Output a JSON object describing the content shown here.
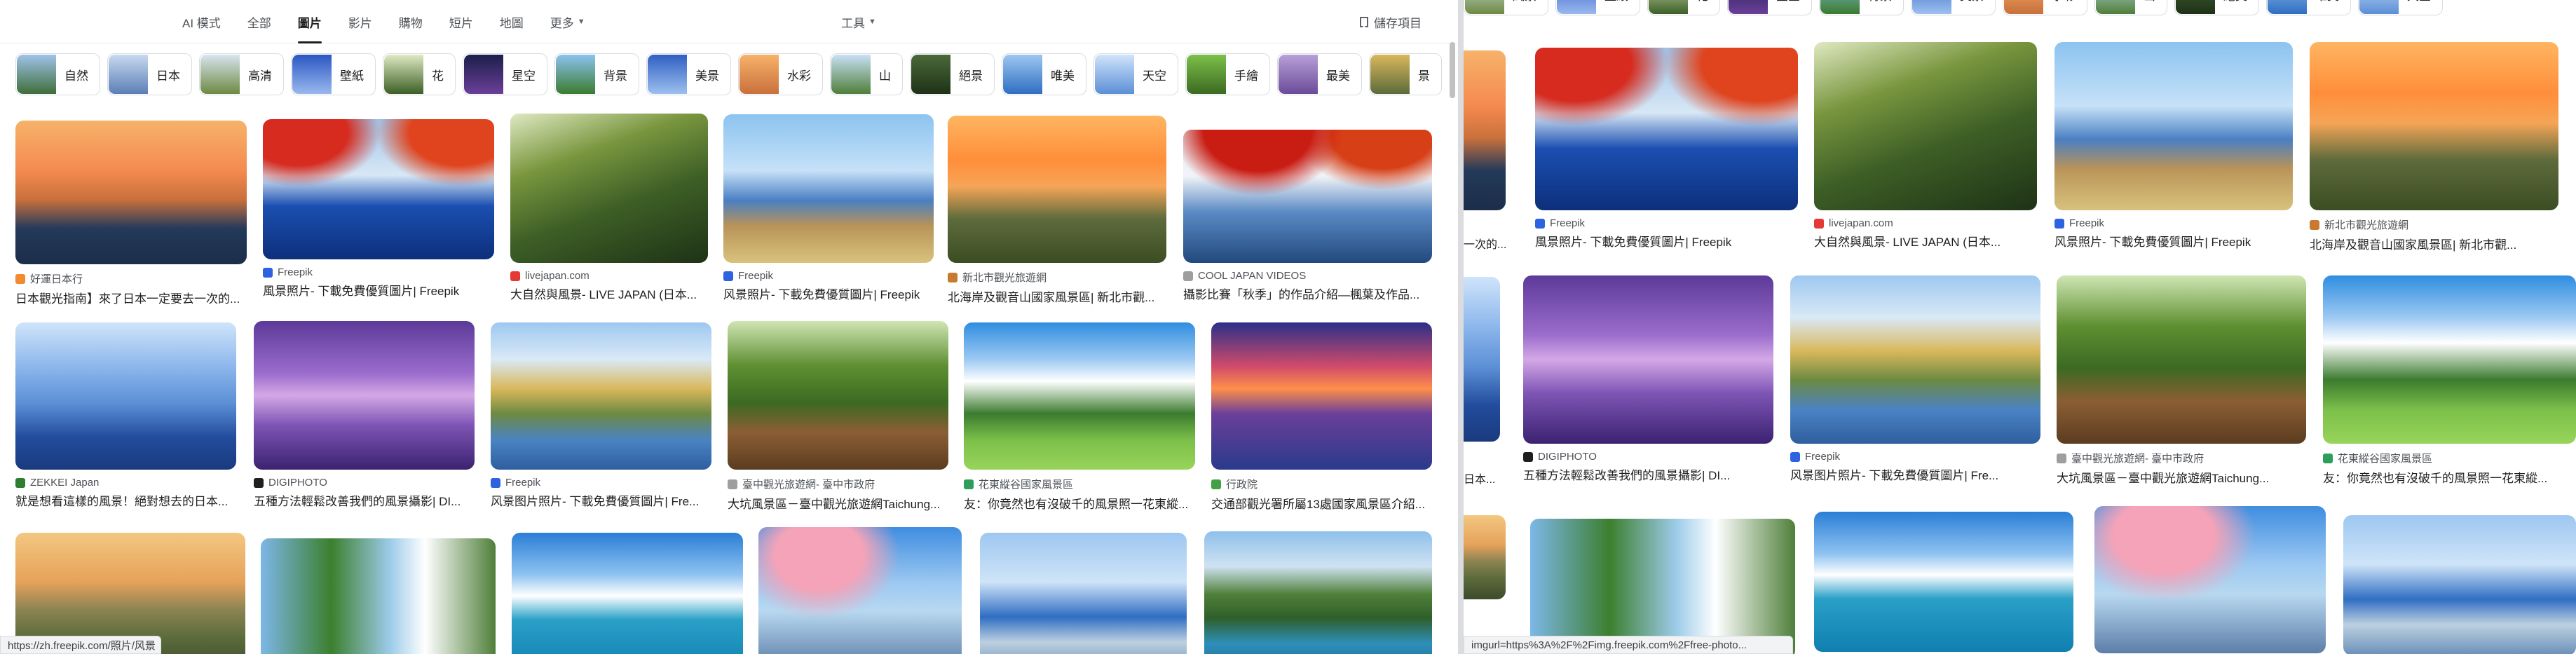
{
  "nav": {
    "tabs": [
      {
        "label": "AI 模式",
        "active": false
      },
      {
        "label": "全部",
        "active": false
      },
      {
        "label": "圖片",
        "active": true
      },
      {
        "label": "影片",
        "active": false
      },
      {
        "label": "購物",
        "active": false
      },
      {
        "label": "短片",
        "active": false
      },
      {
        "label": "地圖",
        "active": false
      },
      {
        "label": "更多",
        "active": false
      }
    ],
    "tools_label": "工具",
    "saved_label": "儲存項目"
  },
  "chips": [
    "自然",
    "日本",
    "高清",
    "壁紙",
    "花",
    "星空",
    "背景",
    "美景",
    "水彩",
    "山",
    "絕景",
    "唯美",
    "天空",
    "手繪",
    "最美",
    "景"
  ],
  "chips_right": [
    "風景",
    "壁紙",
    "花",
    "星空",
    "背景",
    "美景",
    "水彩",
    "山",
    "絕美",
    "唯美",
    "天空"
  ],
  "results_left": [
    {
      "source": "好運日本行",
      "title": "日本觀光指南】來了日本一定要去一次的...",
      "fav": "#f28b30"
    },
    {
      "source": "Freepik",
      "title": "風景照片- 下載免費優質圖片| Freepik",
      "fav": "#2d62e0"
    },
    {
      "source": "livejapan.com",
      "title": "大自然與風景- LIVE JAPAN (日本...",
      "fav": "#e53935"
    },
    {
      "source": "Freepik",
      "title": "风景照片- 下載免費優質圖片| Freepik",
      "fav": "#2d62e0"
    },
    {
      "source": "新北市觀光旅遊網",
      "title": "北海岸及觀音山國家風景區| 新北市觀...",
      "fav": "#c87a2f"
    },
    {
      "source": "COOL JAPAN VIDEOS",
      "title": "攝影比賽「秋季」的作品介紹—楓葉及作品...",
      "fav": "#9e9e9e"
    },
    {
      "source": "ZEKKEI Japan",
      "title": "就是想看這樣的風景！絕對想去的日本...",
      "fav": "#2e7d32"
    },
    {
      "source": "DIGIPHOTO",
      "title": "五種方法輕鬆改善我們的風景攝影| DI...",
      "fav": "#1f1f1f"
    },
    {
      "source": "Freepik",
      "title": "风景图片照片- 下載免費優質圖片| Fre...",
      "fav": "#2d62e0"
    },
    {
      "source": "臺中觀光旅遊網- 臺中市政府",
      "title": "大坑風景區－臺中觀光旅遊網Taichung...",
      "fav": "#9e9e9e"
    },
    {
      "source": "花東縱谷國家風景區",
      "title": "友：你竟然也有沒破千的風景照一花東縱...",
      "fav": "#2e9e5c"
    },
    {
      "source": "行政院",
      "title": "交通部觀光署所屬13處國家風景區介紹...",
      "fav": "#43a047"
    }
  ],
  "results_right": [
    {
      "source": "Freepik",
      "title": "風景照片- 下載免費優質圖片| Freepik",
      "fav": "#2d62e0"
    },
    {
      "source": "livejapan.com",
      "title": "大自然與風景- LIVE JAPAN (日本...",
      "fav": "#e53935"
    },
    {
      "source": "Freepik",
      "title": "风景照片- 下載免費優質圖片| Freepik",
      "fav": "#2d62e0"
    },
    {
      "source": "新北市觀光旅遊網",
      "title": "北海岸及觀音山國家風景區| 新北市觀...",
      "fav": "#c87a2f"
    },
    {
      "source": "DIGIPHOTO",
      "title": "五種方法輕鬆改善我們的風景攝影| DI...",
      "fav": "#1f1f1f"
    },
    {
      "source": "Freepik",
      "title": "风景图片照片- 下載免費優質圖片| Fre...",
      "fav": "#2d62e0"
    },
    {
      "source": "臺中觀光旅遊網- 臺中市政府",
      "title": "大坑風景區－臺中觀光旅遊網Taichung...",
      "fav": "#9e9e9e"
    },
    {
      "source": "花東縱谷國家風景區",
      "title": "友：你竟然也有沒破千的風景照一花東縱...",
      "fav": "#2e9e5c"
    }
  ],
  "right_stub_titles": [
    "一次的...",
    "日本..."
  ],
  "status_left": "https://zh.freepik.com/照片/风景",
  "status_right": "imgurl=https%3A%2F%2Fimg.freepik.com%2Ffree-photo..."
}
